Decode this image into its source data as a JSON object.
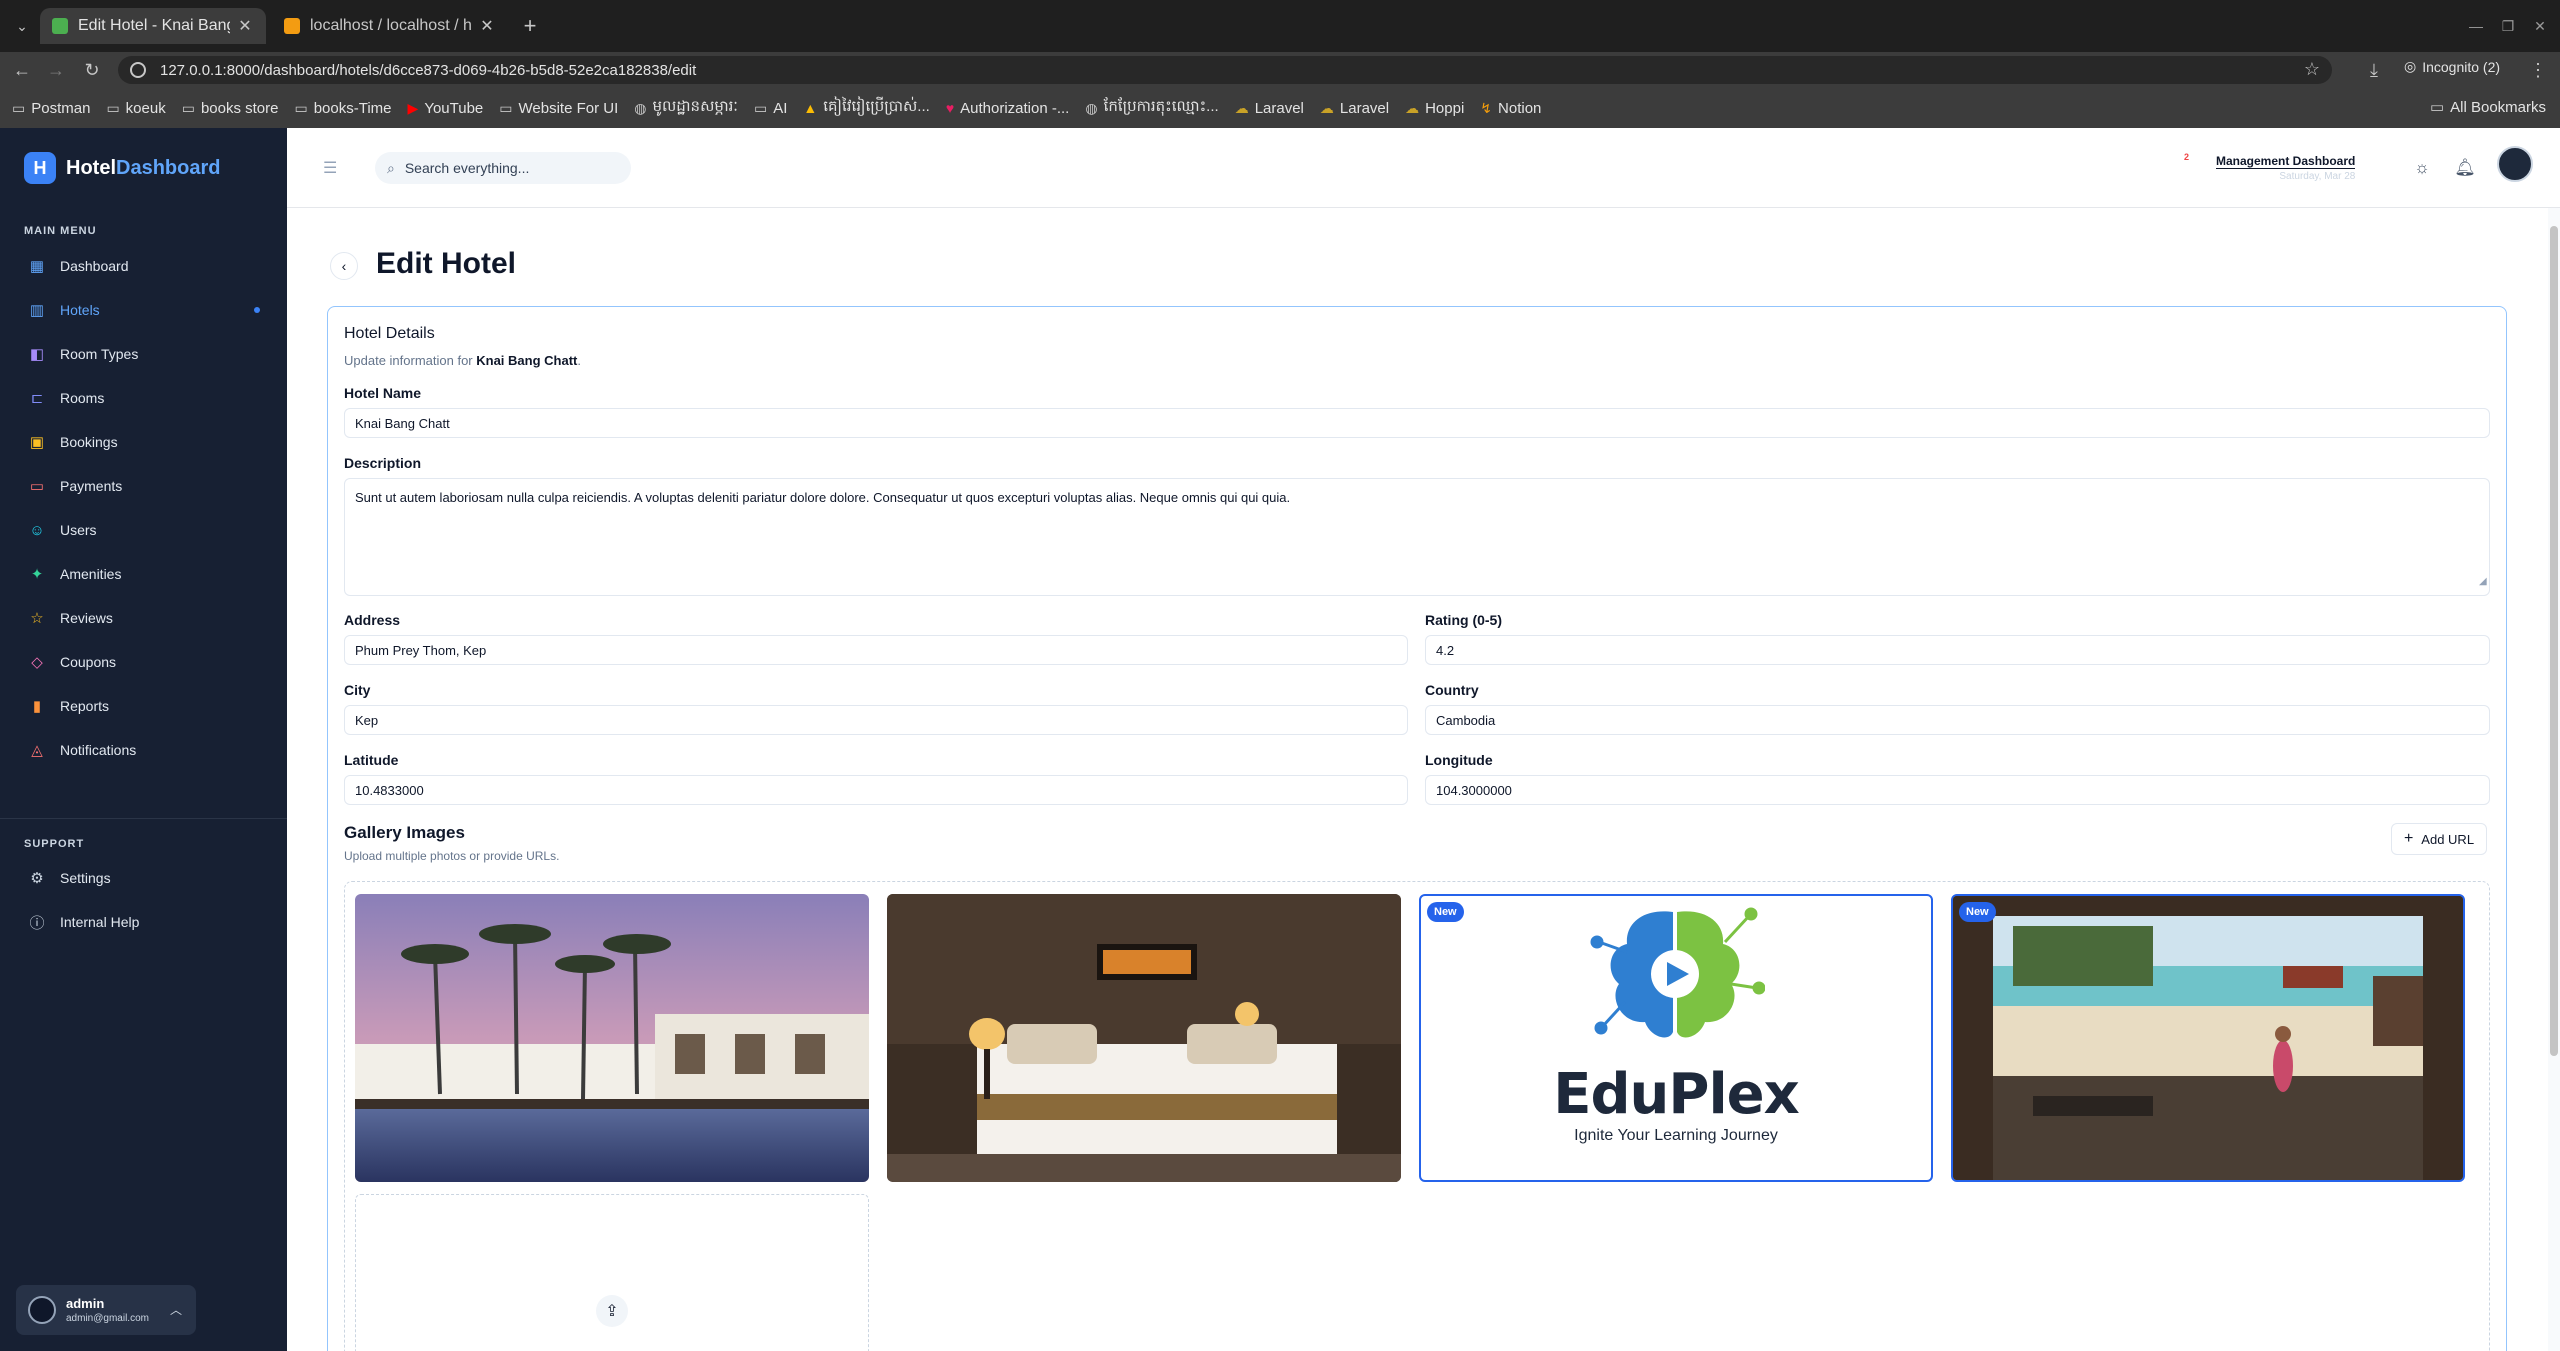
{
  "browser": {
    "tabs": [
      {
        "title": "Edit Hotel - Knai Bang Ch",
        "favicon_color": "#4caf50"
      },
      {
        "title": "localhost / localhost / ho",
        "favicon_color": "#f39c12"
      }
    ],
    "url": "127.0.0.1:8000/dashboard/hotels/d6cce873-d069-4b26-b5d8-52e2ca182838/edit",
    "incognito_label": "Incognito (2)",
    "bookmarks": [
      {
        "label": "Postman",
        "icon": "folder-icon"
      },
      {
        "label": "koeuk",
        "icon": "folder-icon"
      },
      {
        "label": "books store",
        "icon": "folder-icon"
      },
      {
        "label": "books-Time",
        "icon": "folder-icon"
      },
      {
        "label": "YouTube",
        "icon": "youtube-icon"
      },
      {
        "label": "Website For UI",
        "icon": "folder-icon"
      },
      {
        "label": "មូលដ្ឋានសម្ភារៈ",
        "icon": "globe-icon"
      },
      {
        "label": "AI",
        "icon": "folder-icon"
      },
      {
        "label": "គៀវៃរៀប្រើប្រាស់...",
        "icon": "drive-icon"
      },
      {
        "label": "Authorization -...",
        "icon": "heart-icon"
      },
      {
        "label": "កែប្រែការតុះឈ្មោះ...",
        "icon": "globe-icon"
      },
      {
        "label": "Laravel",
        "icon": "cloud-icon"
      },
      {
        "label": "Laravel",
        "icon": "cloud-icon"
      },
      {
        "label": "Hoppi",
        "icon": "cloud-icon"
      },
      {
        "label": "Notion",
        "icon": "bolt-icon"
      }
    ],
    "all_bookmarks_label": "All Bookmarks"
  },
  "sidebar": {
    "brand_first": "Hotel",
    "brand_second": "Dashboard",
    "brand_letter": "H",
    "main_menu_label": "MAIN MENU",
    "items": [
      {
        "label": "Dashboard",
        "icon": "grid-icon",
        "color": "#60a5fa"
      },
      {
        "label": "Hotels",
        "icon": "building-icon",
        "color": "#60a5fa",
        "active": true
      },
      {
        "label": "Room Types",
        "icon": "layers-icon",
        "color": "#a78bfa"
      },
      {
        "label": "Rooms",
        "icon": "bed-icon",
        "color": "#818cf8"
      },
      {
        "label": "Bookings",
        "icon": "calendar-icon",
        "color": "#fbbf24"
      },
      {
        "label": "Payments",
        "icon": "card-icon",
        "color": "#f87171"
      },
      {
        "label": "Users",
        "icon": "users-icon",
        "color": "#22d3ee"
      },
      {
        "label": "Amenities",
        "icon": "sparkle-icon",
        "color": "#34d399"
      },
      {
        "label": "Reviews",
        "icon": "star-icon",
        "color": "#fbbf24"
      },
      {
        "label": "Coupons",
        "icon": "tag-icon",
        "color": "#f472b6"
      },
      {
        "label": "Reports",
        "icon": "bar-chart-icon",
        "color": "#fb923c"
      },
      {
        "label": "Notifications",
        "icon": "bell-icon",
        "color": "#f87171"
      }
    ],
    "support_label": "SUPPORT",
    "support_items": [
      {
        "label": "Settings",
        "icon": "gear-icon"
      },
      {
        "label": "Internal Help",
        "icon": "help-icon"
      }
    ],
    "user": {
      "name": "admin",
      "email": "admin@gmail.com"
    }
  },
  "header": {
    "search_placeholder": "Search everything...",
    "management_title": "Management Dashboard",
    "management_date": "Saturday, Mar 28",
    "notification_count": "2"
  },
  "page": {
    "title": "Edit Hotel",
    "card_title": "Hotel Details",
    "card_subtitle_prefix": "Update information for ",
    "card_subtitle_hotel": "Knai Bang Chatt",
    "card_subtitle_suffix": ".",
    "fields": {
      "hotel_name_label": "Hotel Name",
      "hotel_name": "Knai Bang Chatt",
      "description_label": "Description",
      "description": "Sunt ut autem laboriosam nulla culpa reiciendis. A voluptas deleniti pariatur dolore dolore. Consequatur ut quos excepturi voluptas alias. Neque omnis qui qui quia.",
      "address_label": "Address",
      "address": "Phum Prey Thom, Kep",
      "rating_label": "Rating (0-5)",
      "rating": "4.2",
      "city_label": "City",
      "city": "Kep",
      "country_label": "Country",
      "country": "Cambodia",
      "latitude_label": "Latitude",
      "latitude": "10.4833000",
      "longitude_label": "Longitude",
      "longitude": "104.3000000"
    },
    "gallery": {
      "title": "Gallery Images",
      "subtitle": "Upload multiple photos or provide URLs.",
      "add_url_label": "Add URL",
      "new_badge": "New",
      "eduplex_name": "EduPlex",
      "eduplex_tagline": "Ignite Your Learning Journey"
    }
  },
  "colors": {
    "sidebar_bg": "#172033",
    "accent": "#3b82f6",
    "new_badge": "#2563eb"
  }
}
